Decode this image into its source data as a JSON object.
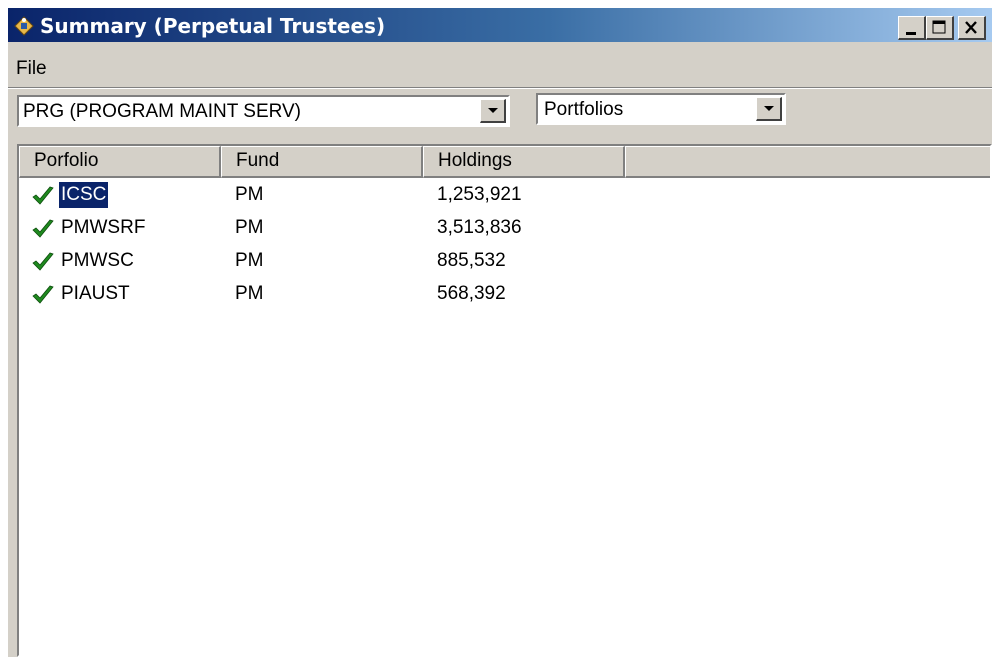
{
  "window": {
    "title": "Summary (Perpetual Trustees)",
    "controls": {
      "minimize": "minimize",
      "maximize": "maximize",
      "close": "close"
    }
  },
  "menu": {
    "items": [
      {
        "label": "File"
      }
    ]
  },
  "filters": {
    "group": {
      "value": "PRG (PROGRAM MAINT SERV)"
    },
    "view": {
      "value": "Portfolios"
    }
  },
  "table": {
    "columns": [
      "Porfolio",
      "Fund",
      "Holdings",
      ""
    ],
    "rows": [
      {
        "portfolio": "ICSC",
        "fund": "PM",
        "holdings": "1,253,921",
        "checked": true,
        "selected": true
      },
      {
        "portfolio": "PMWSRF",
        "fund": "PM",
        "holdings": "3,513,836",
        "checked": true,
        "selected": false
      },
      {
        "portfolio": "PMWSC",
        "fund": "PM",
        "holdings": "885,532",
        "checked": true,
        "selected": false
      },
      {
        "portfolio": "PIAUST",
        "fund": "PM",
        "holdings": "568,392",
        "checked": true,
        "selected": false
      }
    ]
  },
  "icons": {
    "app": "app-icon",
    "check": "check-icon",
    "dropdown": "dropdown-arrow-icon"
  },
  "colors": {
    "title_start": "#0a246a",
    "title_end": "#a6caf0",
    "selection": "#0a246a",
    "check": "#1f8a1f"
  }
}
